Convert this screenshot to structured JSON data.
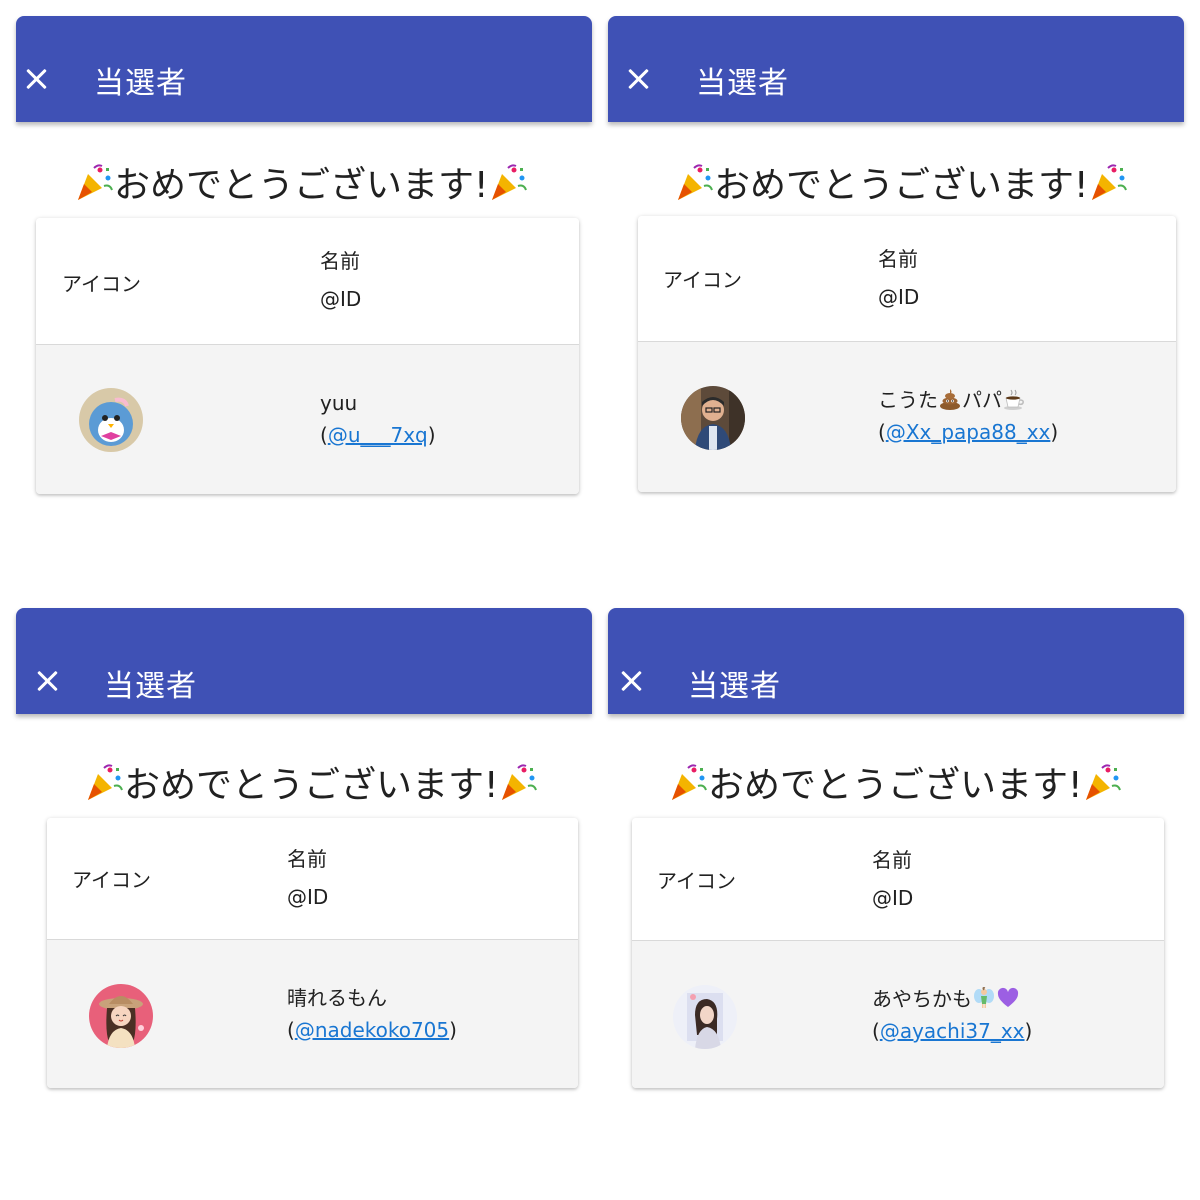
{
  "dialog": {
    "title": "当選者",
    "congrats_text": "おめでとうございます!",
    "table": {
      "col_icon": "アイコン",
      "col_name": "名前",
      "col_id": "@ID"
    }
  },
  "winners": [
    {
      "name": "yuu",
      "handle": "@u___7xq",
      "avatar": "penguin-plush-avatar"
    },
    {
      "name_parts": [
        "こうた",
        "パパ"
      ],
      "name_emojis": [
        "poop-emoji",
        "coffee-emoji"
      ],
      "handle": "@Xx_papa88_xx",
      "avatar": "man-with-glasses-avatar"
    },
    {
      "name": "晴れるもん",
      "handle": "@nadekoko705",
      "avatar": "girl-with-hat-avatar"
    },
    {
      "name": "あやちかも",
      "name_emojis": [
        "fairy-emoji",
        "purple-heart-emoji"
      ],
      "handle": "@ayachi37_xx",
      "avatar": "woman-photo-avatar"
    }
  ],
  "punct": {
    "open": "(",
    "close": ")"
  },
  "colors": {
    "appbar": "#3f51b5",
    "link": "#1976d2",
    "row_bg": "#f4f4f4"
  }
}
